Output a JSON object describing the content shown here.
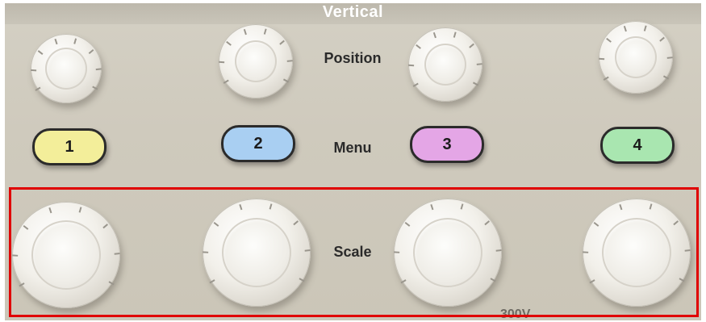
{
  "section_title": "Vertical",
  "labels": {
    "position": "Position",
    "menu": "Menu",
    "scale": "Scale"
  },
  "channel_buttons": [
    {
      "label": "1",
      "color": "#f3ee9a"
    },
    {
      "label": "2",
      "color": "#a9cff2"
    },
    {
      "label": "3",
      "color": "#e4a6e6"
    },
    {
      "label": "4",
      "color": "#a9e6b0"
    }
  ],
  "footer_text": "300V",
  "highlight_color": "#e00000",
  "icons": {
    "position_knobs": "knob-icon",
    "scale_knobs": "knob-icon"
  }
}
